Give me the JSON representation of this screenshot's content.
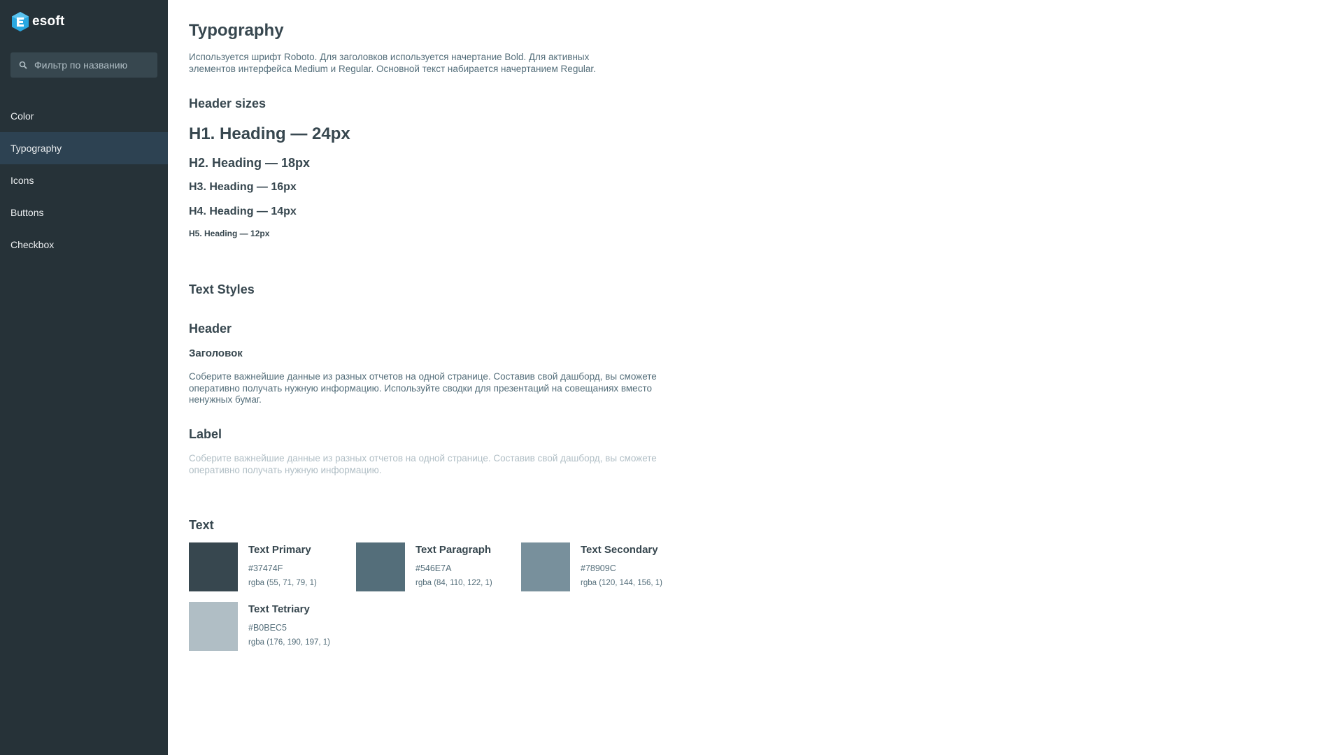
{
  "sidebar": {
    "logo_text": "esoft",
    "search_placeholder": "Фильтр по названию",
    "items": [
      {
        "label": "Color"
      },
      {
        "label": "Typography"
      },
      {
        "label": "Icons"
      },
      {
        "label": "Buttons"
      },
      {
        "label": "Checkbox"
      }
    ],
    "active_item": "Typography"
  },
  "main": {
    "title": "Typography",
    "intro": "Используется шрифт Roboto. Для заголовков используется начертание Bold. Для активных элементов интерфейса Medium и Regular. Основной текст набирается начертанием Regular.",
    "header_sizes": {
      "title": "Header sizes",
      "h1": "H1. Heading — 24px",
      "h2": "H2. Heading — 18px",
      "h3": "H3. Heading — 16px",
      "h4": "H4. Heading — 14px",
      "h5": "H5. Heading — 12px"
    },
    "text_styles": {
      "title": "Text Styles",
      "header_title": "Header",
      "header_sample": "Заголовок",
      "header_paragraph": "Соберите важнейшие данные из разных отчетов на одной странице. Составив свой дашборд, вы сможете оперативно получать нужную информацию. Используйте сводки для презентаций на совещаниях вместо ненужных бумаг.",
      "label_title": "Label",
      "label_paragraph": "Соберите важнейшие данные из разных отчетов на одной странице. Составив свой дашборд, вы сможете оперативно получать нужную информацию."
    },
    "text_colors": {
      "title": "Text",
      "swatches": [
        {
          "name": "Text Primary",
          "hex": "#37474F",
          "rgba": "rgba (55, 71, 79, 1)",
          "color": "#37474F"
        },
        {
          "name": "Text Paragraph",
          "hex": "#546E7A",
          "rgba": "rgba (84, 110, 122, 1)",
          "color": "#546E7A"
        },
        {
          "name": "Text Secondary",
          "hex": "#78909C",
          "rgba": "rgba (120, 144, 156, 1)",
          "color": "#78909C"
        },
        {
          "name": "Text Tetriary",
          "hex": "#B0BEC5",
          "rgba": "rgba (176, 190, 197, 1)",
          "color": "#B0BEC5"
        }
      ]
    }
  },
  "colors": {
    "sidebar_bg": "#263238",
    "sidebar_active": "#2D4252",
    "logo_blue": "#29A8E0"
  }
}
